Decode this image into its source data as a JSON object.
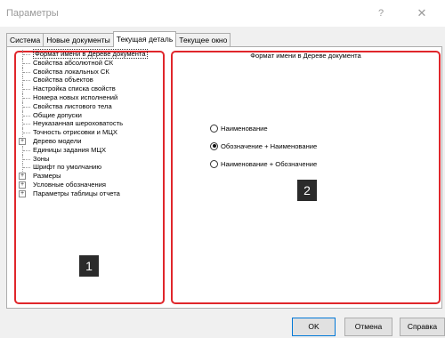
{
  "window": {
    "title": "Параметры",
    "help_label": "?",
    "close_label": "✕"
  },
  "tabs": [
    {
      "label": "Система",
      "active": false
    },
    {
      "label": "Новые документы",
      "active": false
    },
    {
      "label": "Текущая деталь",
      "active": true
    },
    {
      "label": "Текущее окно",
      "active": false
    }
  ],
  "tree": {
    "items": [
      {
        "label": "Формат имени в Дереве документа",
        "expandable": false,
        "selected": true
      },
      {
        "label": "Свойства абсолютной СК",
        "expandable": false
      },
      {
        "label": "Свойства локальных СК",
        "expandable": false
      },
      {
        "label": "Свойства объектов",
        "expandable": false
      },
      {
        "label": "Настройка списка свойств",
        "expandable": false
      },
      {
        "label": "Номера новых исполнений",
        "expandable": false
      },
      {
        "label": "Свойства листового тела",
        "expandable": false
      },
      {
        "label": "Общие допуски",
        "expandable": false
      },
      {
        "label": "Неуказанная шероховатость",
        "expandable": false
      },
      {
        "label": "Точность отрисовки и МЦХ",
        "expandable": false
      },
      {
        "label": "Дерево модели",
        "expandable": true
      },
      {
        "label": "Единицы задания МЦХ",
        "expandable": false
      },
      {
        "label": "Зоны",
        "expandable": false
      },
      {
        "label": "Шрифт по умолчанию",
        "expandable": false
      },
      {
        "label": "Размеры",
        "expandable": true
      },
      {
        "label": "Условные обозначения",
        "expandable": true
      },
      {
        "label": "Параметры таблицы отчета",
        "expandable": true
      }
    ],
    "expander_symbol": "+"
  },
  "format_panel": {
    "title": "Формат имени в Дереве документа",
    "options": [
      {
        "label": "Наименование",
        "checked": false
      },
      {
        "label": "Обозначение + Наименование",
        "checked": true
      },
      {
        "label": "Наименование + Обозначение",
        "checked": false
      }
    ]
  },
  "badges": {
    "left": "1",
    "right": "2"
  },
  "buttons": {
    "ok": "OK",
    "cancel": "Отмена",
    "help": "Справка"
  },
  "colors": {
    "highlight_border": "#e0262b",
    "badge_bg": "#2b2b2b",
    "default_button_border": "#0078d7"
  }
}
